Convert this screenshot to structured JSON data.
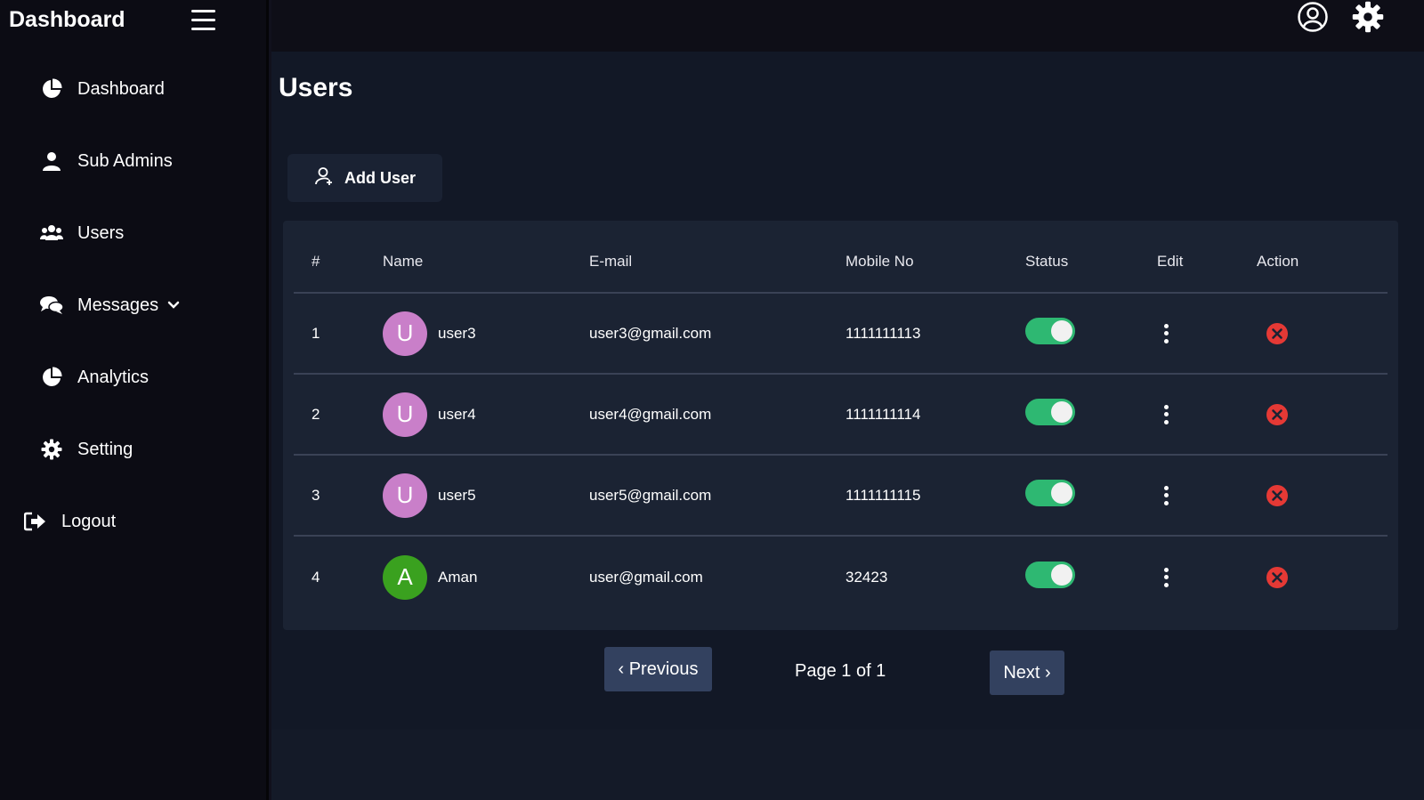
{
  "sidebar": {
    "brand": "Dashboard",
    "items": [
      {
        "label": "Dashboard",
        "icon": "pie-chart-icon"
      },
      {
        "label": "Sub Admins",
        "icon": "user-icon"
      },
      {
        "label": "Users",
        "icon": "users-icon"
      },
      {
        "label": "Messages",
        "icon": "chat-icon"
      },
      {
        "label": "Analytics",
        "icon": "pie-chart-icon"
      },
      {
        "label": "Setting",
        "icon": "gear-icon"
      },
      {
        "label": "Logout",
        "icon": "logout-icon"
      }
    ]
  },
  "main": {
    "title": "Users",
    "add_user_label": "Add User",
    "table": {
      "headers": [
        "#",
        "Name",
        "E-mail",
        "Mobile No",
        "Status",
        "Edit",
        "Action"
      ],
      "rows": [
        {
          "num": "1",
          "initial": "U",
          "avatar_color": "#c97fc9",
          "name": "user3",
          "email": "user3@gmail.com",
          "mobile": "1111111113",
          "status": true
        },
        {
          "num": "2",
          "initial": "U",
          "avatar_color": "#c97fc9",
          "name": "user4",
          "email": "user4@gmail.com",
          "mobile": "1111111114",
          "status": true
        },
        {
          "num": "3",
          "initial": "U",
          "avatar_color": "#c97fc9",
          "name": "user5",
          "email": "user5@gmail.com",
          "mobile": "1111111115",
          "status": true
        },
        {
          "num": "4",
          "initial": "A",
          "avatar_color": "#3aa11f",
          "name": "Aman",
          "email": "user@gmail.com",
          "mobile": "32423",
          "status": true
        }
      ]
    },
    "pagination": {
      "previous_label": "‹ Previous",
      "page_info": "Page 1 of 1",
      "next_label": "Next ›"
    }
  },
  "colors": {
    "toggle_on": "#2eb872",
    "delete": "#e53935",
    "button_bg": "#33415f"
  }
}
